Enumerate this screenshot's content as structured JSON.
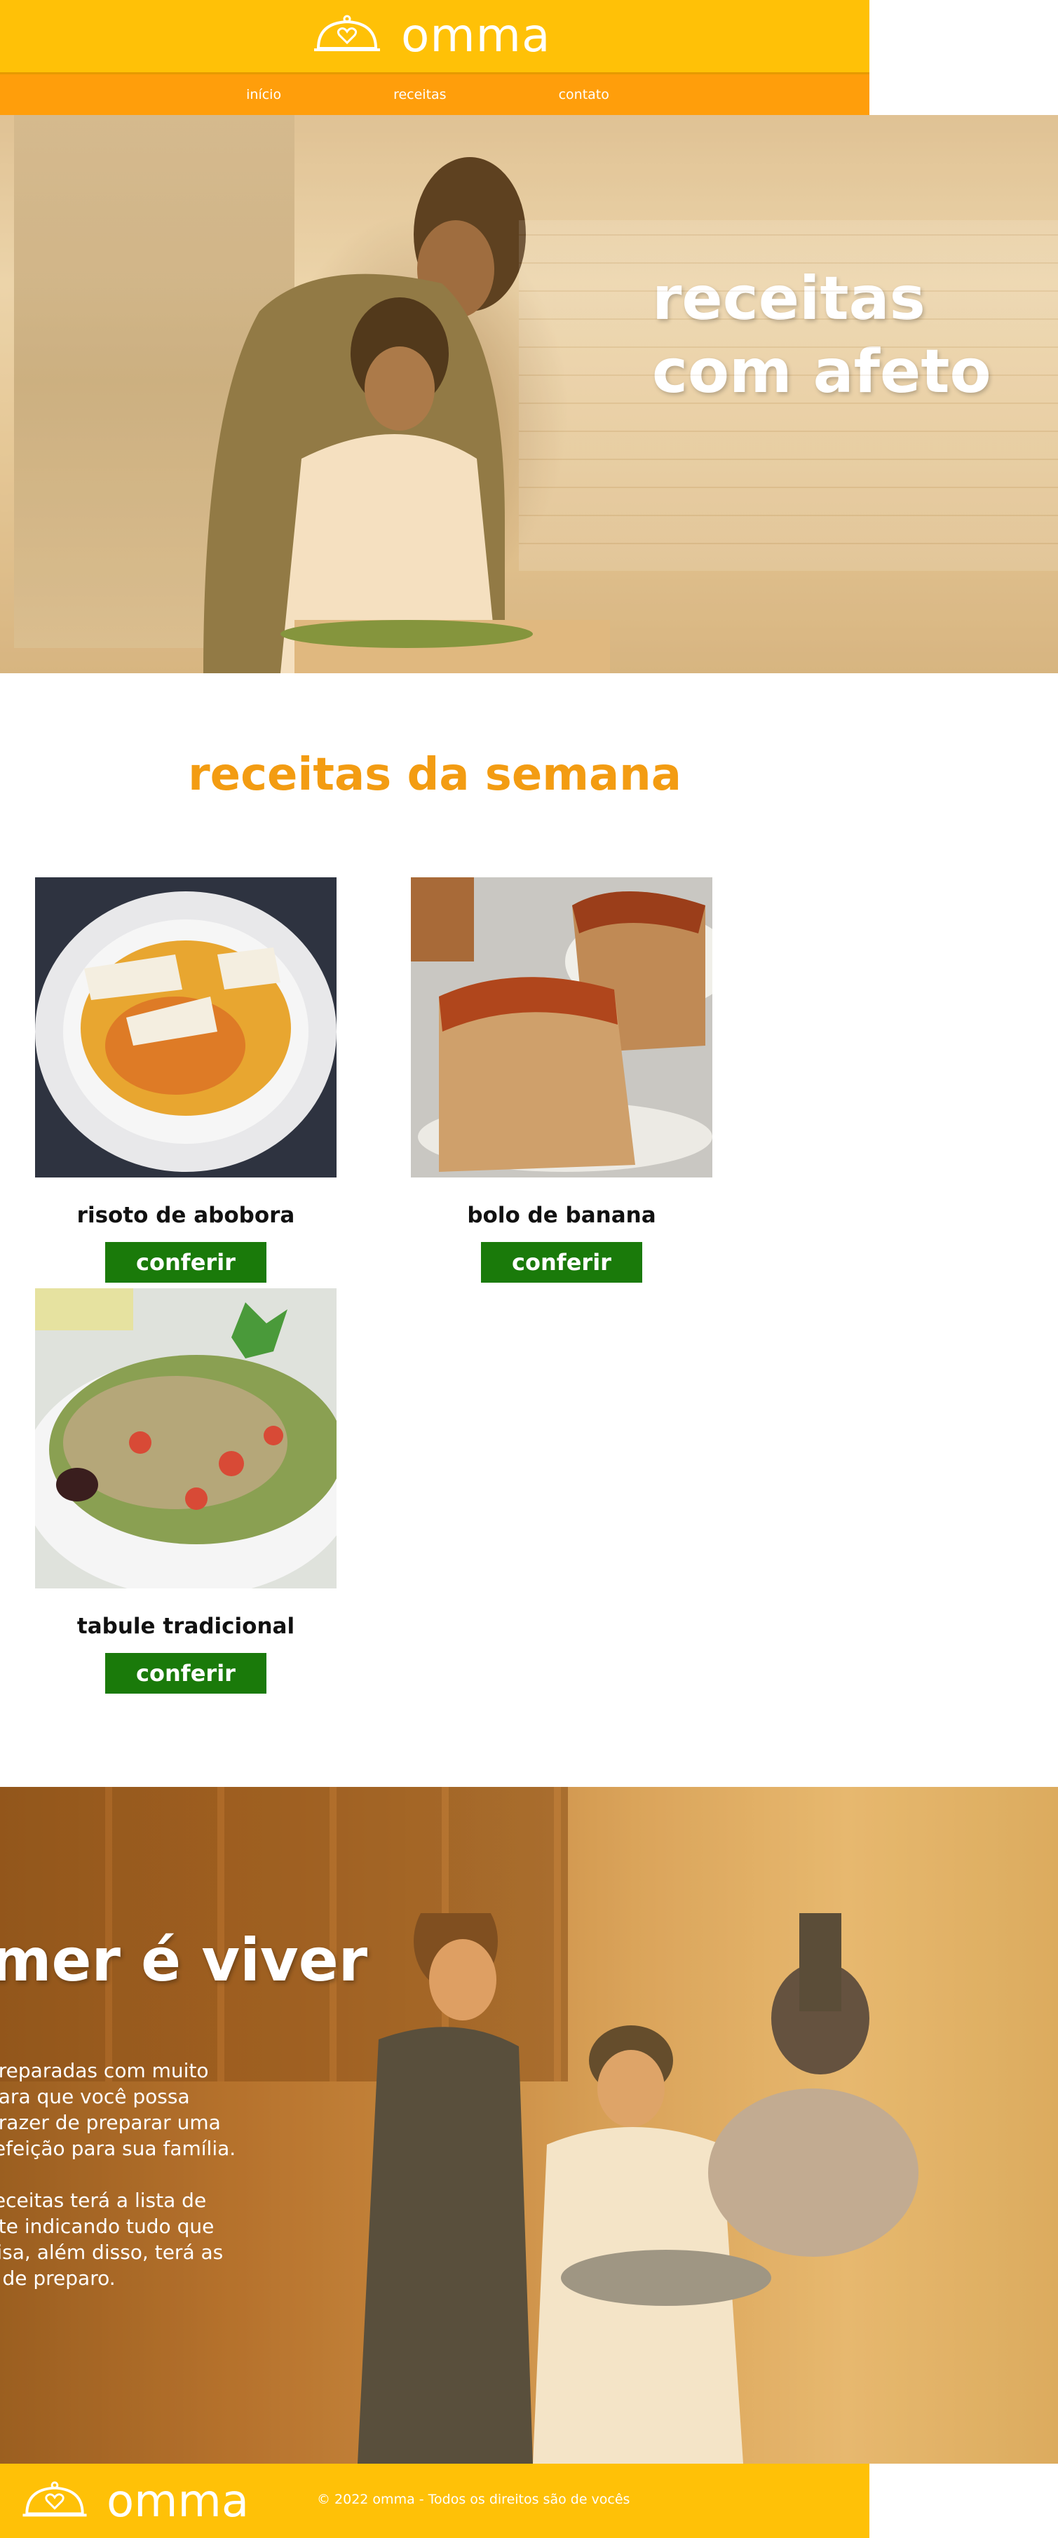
{
  "brand": {
    "name": "omma"
  },
  "nav": {
    "items": [
      {
        "label": "início"
      },
      {
        "label": "receitas"
      },
      {
        "label": "contato"
      }
    ]
  },
  "hero": {
    "title_line1": "receitas",
    "title_line2": "com afeto"
  },
  "recipes": {
    "title": "receitas da semana",
    "items": [
      {
        "name": "risoto de abobora",
        "button": "conferir"
      },
      {
        "name": "bolo de banana",
        "button": "conferir"
      },
      {
        "name": "tabule tradicional",
        "button": "conferir"
      }
    ]
  },
  "about": {
    "title": "mer é viver",
    "text": " preparadas com muito\n para que você possa\nprazer de preparar uma\n refeição para sua família.\n\n receitas terá a lista de\nnte indicando tudo que\ncisa, além disso, terá as\ns de preparo."
  },
  "footer": {
    "copyright": "© 2022 omma - Todos os direitos são de vocês"
  },
  "colors": {
    "header": "#ffc107",
    "nav": "#ff9e0b",
    "title_orange": "#f39c12",
    "button_green": "#1a7a0a"
  }
}
